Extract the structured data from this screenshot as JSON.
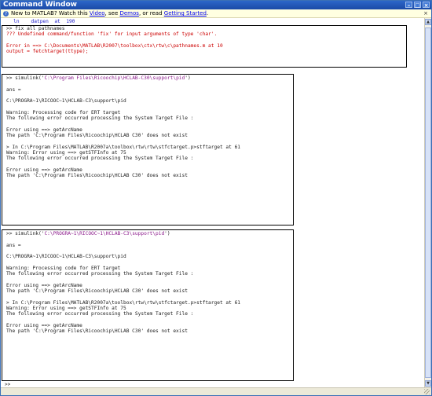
{
  "window": {
    "title": "Command Window"
  },
  "infobar": {
    "text": "New to MATLAB? Watch this ",
    "link1": "Video",
    "mid1": ", see ",
    "link2": "Demos",
    "mid2": ", or read ",
    "link3": "Getting Started",
    "end": "."
  },
  "top": {
    "line0": "   ln    datpen  at  190"
  },
  "box1": {
    "l1": ">> fix all pathnames",
    "l2": "??? Undefined command/function 'fix' for input arguments of type 'char'.",
    "l3": "Error in ==> C:\\Documents\\MATLAB\\R2007\\toolbox\\ctx\\rtw\\c\\pathnames.m at 10",
    "l4": "output = fetchtarget(ttype);"
  },
  "box2": {
    "cmd_prefix": ">> simulink('",
    "cmd_path": "C:\\Program Files\\Ricoochip\\HCLAB-C30\\support\\pid",
    "cmd_suffix": "')",
    "ans": "ans =",
    "path": "C:\\PROGRA~1\\RICOOC~1\\HCLAB-C3\\support\\pid",
    "warn1": "Warning: Processing code for ERT target",
    "warn2": "The following error occurred processing the System Target File :",
    "err1": "Error using ==> getArcName",
    "err2": "The path 'C:\\Program Files\\Ricoochip\\HCLAB C30' does not exist",
    "in1": "> In C:\\Program Files\\MATLAB\\R2007a\\toolbox\\rtw\\rtw\\stfctarget.p>stftarget at 61",
    "warn3": "Warning: Error using ==> getSTFInfo at 75",
    "warn4": "The following error occurred processing the System Target File :",
    "err3": "Error using ==> getArcName",
    "err4": "The path 'C:\\Program Files\\Ricoochip\\HCLAB C30' does not exist"
  },
  "box3": {
    "cmd_prefix": ">> simulink('",
    "cmd_path": "C:\\PROGRA~1\\RICOOC~1\\HCLAB-C3\\support\\pid",
    "cmd_suffix": "')",
    "ans": "ans =",
    "path": "C:\\PROGRA~1\\RICOOC~1\\HCLAB-C3\\support\\pid",
    "warn1": "Warning: Processing code for ERT target",
    "warn2": "The following error occurred processing the System Target File :",
    "err1": "Error using ==> getArcName",
    "err2": "The path 'C:\\Program Files\\Ricoochip\\HCLAB C30' does not exist",
    "in1": "> In C:\\Program Files\\MATLAB\\R2007a\\toolbox\\rtw\\rtw\\stfctarget.p>stftarget at 61",
    "warn3": "Warning: Error using ==> getSTFInfo at 75",
    "warn4": "The following error occurred processing the System Target File :",
    "err3": "Error using ==> getArcName",
    "err4": "The path 'C:\\Program Files\\Ricoochip\\HCLAB C30' does not exist"
  },
  "prompt": ">>"
}
